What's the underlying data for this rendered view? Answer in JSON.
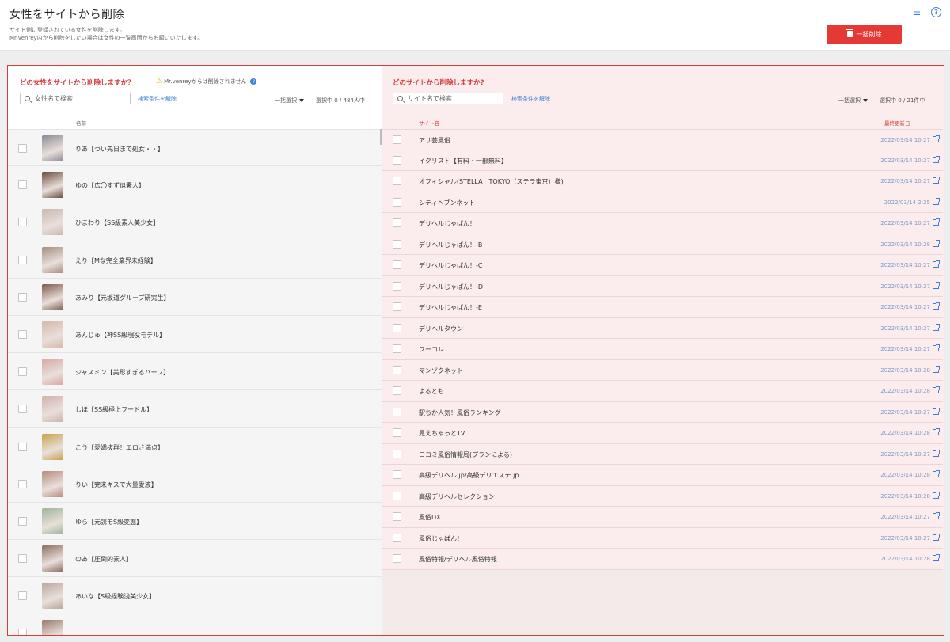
{
  "header": {
    "title": "女性をサイトから削除",
    "description_line1": "サイト側に登録されている女性を削除します。",
    "description_line2": "Mr.Venrey内から削除をしたい場合は女性の一覧画面からお願いいたします。",
    "bulk_delete_label": "一括削除",
    "list_icon": "list-icon",
    "help_icon": "help-icon"
  },
  "left": {
    "question": "どの女性をサイトから削除しますか？",
    "warning": "Mr.venreyからは削除されません",
    "search_placeholder": "女性名で検索",
    "clear_link": "検索条件を解除",
    "bulk_select": "一括選択",
    "count": "選択中  0 / 484人中",
    "column_name": "名前",
    "girls": [
      {
        "name": "りあ【つい先日まで処女・・】",
        "color": "#8a8a95"
      },
      {
        "name": "ゆの【広〇すず似素人】",
        "color": "#6b4a3e"
      },
      {
        "name": "ひまわり【SS級素人美少女】",
        "color": "#c9b8b0"
      },
      {
        "name": "えり【Mな完全業界未経験】",
        "color": "#a58d80"
      },
      {
        "name": "あみり【元坂道グループ研究生】",
        "color": "#7e5a4c"
      },
      {
        "name": "あんじゅ【神SS級現役モデル】",
        "color": "#d7b8a8"
      },
      {
        "name": "ジャスミン【美形すぎるハーフ】",
        "color": "#d8a7a3"
      },
      {
        "name": "しほ【SS級極上フードル】",
        "color": "#cfb1ab"
      },
      {
        "name": "こう【愛嬌抜群！エロさ満点】",
        "color": "#c9a24d"
      },
      {
        "name": "りい【完未キスで大量愛液】",
        "color": "#b78b7a"
      },
      {
        "name": "ゆら【元読モS級変態】",
        "color": "#9fb39a"
      },
      {
        "name": "のあ【圧倒的素人】",
        "color": "#8b6e61"
      },
      {
        "name": "あいな【S級経験浅美少女】",
        "color": "#b8a79c"
      },
      {
        "name": "",
        "color": "#9a7768"
      }
    ]
  },
  "right": {
    "question": "どのサイトから削除しますか?",
    "search_placeholder": "サイト名で検索",
    "clear_link": "検索条件を解除",
    "bulk_select": "一括選択",
    "count": "選択中  0 / 21件中",
    "column_site": "サイト名",
    "column_updated": "最終更新日",
    "sites": [
      {
        "name": "アサ芸風俗",
        "date": "2022/03/14 10:27"
      },
      {
        "name": "イクリスト【有料・一部無料】",
        "date": "2022/03/14 10:27"
      },
      {
        "name": "オフィシャル(STELLA　TOKYO（ステラ東京）様)",
        "date": "2022/03/14 10:27"
      },
      {
        "name": "シティヘブンネット",
        "date": "2022/03/14 2:25"
      },
      {
        "name": "デリヘルじゃぱん！",
        "date": "2022/03/14 10:27"
      },
      {
        "name": "デリヘルじゃぱん！-B",
        "date": "2022/03/14 10:28"
      },
      {
        "name": "デリヘルじゃぱん！-C",
        "date": "2022/03/14 10:27"
      },
      {
        "name": "デリヘルじゃぱん！-D",
        "date": "2022/03/14 10:27"
      },
      {
        "name": "デリヘルじゃぱん！-E",
        "date": "2022/03/14 10:27"
      },
      {
        "name": "デリヘルタウン",
        "date": "2022/03/14 10:27"
      },
      {
        "name": "フーコレ",
        "date": "2022/03/14 10:27"
      },
      {
        "name": "マンゾクネット",
        "date": "2022/03/14 10:28"
      },
      {
        "name": "よるとも",
        "date": "2022/03/14 10:28"
      },
      {
        "name": "駅ちか人気！風俗ランキング",
        "date": "2022/03/14 10:27"
      },
      {
        "name": "見えちゃっとTV",
        "date": "2022/03/14 10:28"
      },
      {
        "name": "口コミ風俗情報局(プランによる)",
        "date": "2022/03/14 10:27"
      },
      {
        "name": "高級デリヘル.jp/高級デリエステ.jp",
        "date": "2022/03/14 10:28"
      },
      {
        "name": "高級デリヘルセレクション",
        "date": "2022/03/14 10:28"
      },
      {
        "name": "風俗DX",
        "date": "2022/03/14 10:27"
      },
      {
        "name": "風俗じゃぱん！",
        "date": "2022/03/14 10:27"
      },
      {
        "name": "風俗特報/デリヘル風俗特報",
        "date": "2022/03/14 10:28"
      }
    ]
  },
  "colors": {
    "accent_red": "#d33d3d",
    "button_red": "#e53935",
    "link_blue": "#3f7fd8",
    "right_bg": "#fbeded"
  }
}
